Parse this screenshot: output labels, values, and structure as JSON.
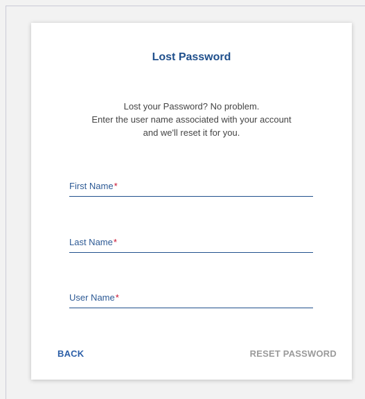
{
  "dialog": {
    "title": "Lost Password",
    "description": [
      "Lost your Password? No problem.",
      "Enter the user name associated with your account",
      "and we'll reset it for you."
    ],
    "fields": [
      {
        "label": "First Name",
        "required_mark": "*",
        "value": ""
      },
      {
        "label": "Last Name",
        "required_mark": "*",
        "value": ""
      },
      {
        "label": "User Name",
        "required_mark": "*",
        "value": ""
      }
    ],
    "buttons": {
      "back_label": "BACK",
      "reset_label": "RESET PASSWORD"
    }
  },
  "colors": {
    "accent": "#1f4f8c",
    "link": "#2b5ea7",
    "required": "#c8102e",
    "disabled": "#9a9a9a"
  }
}
